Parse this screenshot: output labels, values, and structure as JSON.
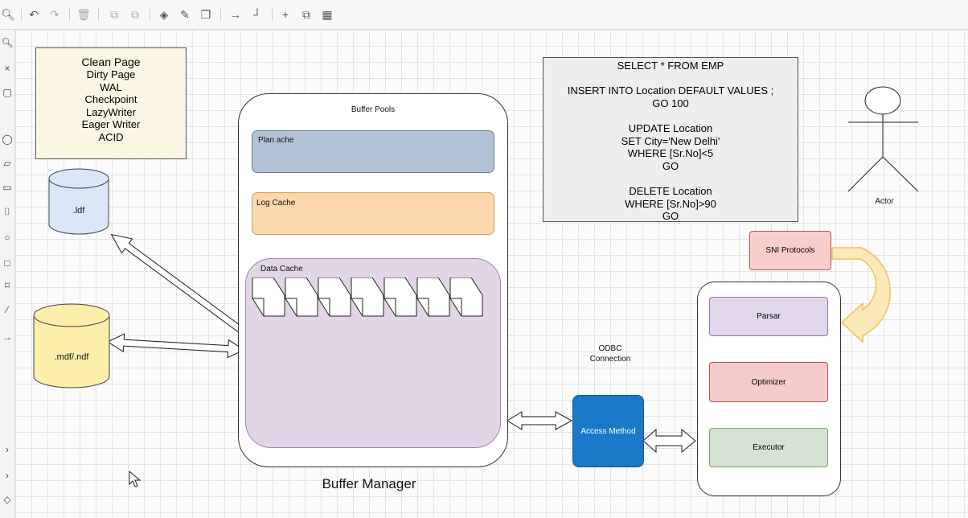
{
  "toolbar": {
    "items": [
      "zoom-icon",
      "undo-icon",
      "redo-icon",
      "delete-icon",
      "to-front-icon",
      "to-back-icon",
      "fill-color-icon",
      "line-color-icon",
      "shadow-icon",
      "connection-arrow-icon",
      "waypoint-icon",
      "insert-icon",
      "shapes-icon",
      "table-icon"
    ]
  },
  "legend_note": {
    "title": "Clean Page",
    "lines": [
      "Dirty Page",
      "WAL",
      "Checkpoint",
      "LazyWriter",
      "Eager Writer",
      "ACID"
    ]
  },
  "files": {
    "ldf": ".ldf",
    "mdf": ".mdf/.ndf"
  },
  "buffer_manager": {
    "pool_title": "Buffer Pools",
    "plan_cache": "Plan ache",
    "log_cache": "Log Cache",
    "data_cache": "Data Cache",
    "label": "Buffer Manager",
    "page_count": 7
  },
  "sql_box": {
    "lines": [
      "SELECT * FROM EMP",
      "",
      "INSERT INTO Location DEFAULT VALUES ;",
      "GO 100",
      "",
      "UPDATE Location",
      "SET City='New Delhi'",
      "WHERE [Sr.No]<5",
      "GO",
      "",
      "DELETE Location",
      "WHERE [Sr.No]>90",
      "GO"
    ]
  },
  "actor": {
    "label": "Actor"
  },
  "sni": {
    "label": "SNI Protocols"
  },
  "relational_engine": {
    "parser": "Parsar",
    "optimizer": "Optimizer",
    "executor": "Executor"
  },
  "odbc": {
    "line1": "ODBC",
    "line2": "Connection"
  },
  "access_method": {
    "label": "Access Method"
  },
  "colors": {
    "note_fill": "#fbf6e4",
    "plan_fill": "#b1c3d4",
    "log_fill": "#fbd7ad",
    "data_fill": "#e2d5e6",
    "ldf_fill": "#d9e7f8",
    "mdf_fill": "#fdefaa",
    "sni_fill": "#f8cecb",
    "access_fill": "#1a7ac9",
    "parser_fill": "#e2d7ea",
    "optimizer_fill": "#f5cccb",
    "executor_fill": "#d4e2d1",
    "curve_arrow": "#fde8b8"
  }
}
